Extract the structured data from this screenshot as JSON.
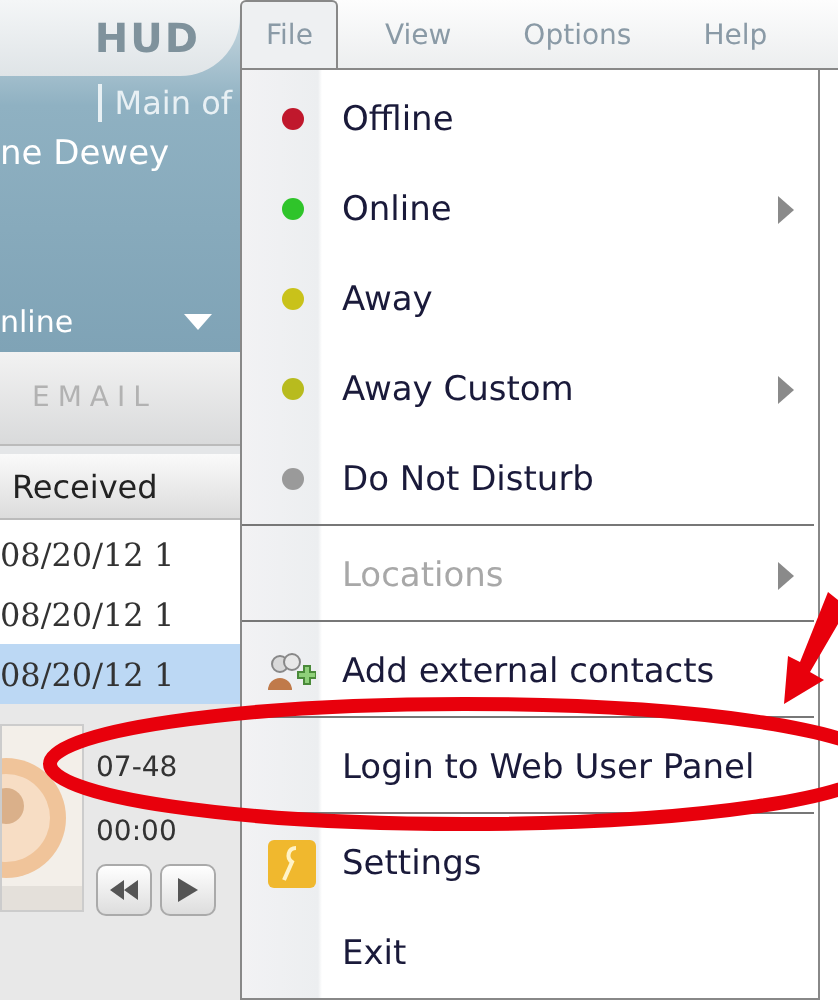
{
  "app": {
    "logo": "HUD",
    "line_name": "Main of",
    "user_name": "ne Dewey",
    "status": "nline",
    "tab": "EMAIL",
    "column": "Received",
    "rows": [
      {
        "received": "08/20/12 1",
        "selected": false
      },
      {
        "received": "08/20/12 1",
        "selected": false
      },
      {
        "received": "08/20/12 1",
        "selected": true
      }
    ],
    "phone": "07-48",
    "timer": "00:00"
  },
  "menubar": [
    {
      "label": "File",
      "selected": true
    },
    {
      "label": "View",
      "selected": false
    },
    {
      "label": "Options",
      "selected": false
    },
    {
      "label": "Help",
      "selected": false
    }
  ],
  "menu": [
    {
      "kind": "status",
      "label": "Offline",
      "color": "#c0182c",
      "submenu": false,
      "disabled": false
    },
    {
      "kind": "status",
      "label": "Online",
      "color": "#2fc42a",
      "submenu": true,
      "disabled": false
    },
    {
      "kind": "status",
      "label": "Away",
      "color": "#c9c21a",
      "submenu": false,
      "disabled": false
    },
    {
      "kind": "status",
      "label": "Away Custom",
      "color": "#b8bb1e",
      "submenu": true,
      "disabled": false
    },
    {
      "kind": "status",
      "label": "Do Not Disturb",
      "color": "#9a9a9a",
      "submenu": false,
      "disabled": false
    },
    {
      "kind": "separator"
    },
    {
      "kind": "plain",
      "label": "Locations",
      "submenu": true,
      "disabled": true
    },
    {
      "kind": "separator"
    },
    {
      "kind": "contacts",
      "label": "Add external contacts",
      "submenu": false,
      "disabled": false
    },
    {
      "kind": "separator"
    },
    {
      "kind": "plain",
      "label": "Login to Web User Panel",
      "submenu": false,
      "disabled": false
    },
    {
      "kind": "separator"
    },
    {
      "kind": "settings",
      "label": "Settings",
      "submenu": false,
      "disabled": false
    },
    {
      "kind": "plain",
      "label": "Exit",
      "submenu": false,
      "disabled": false
    }
  ]
}
